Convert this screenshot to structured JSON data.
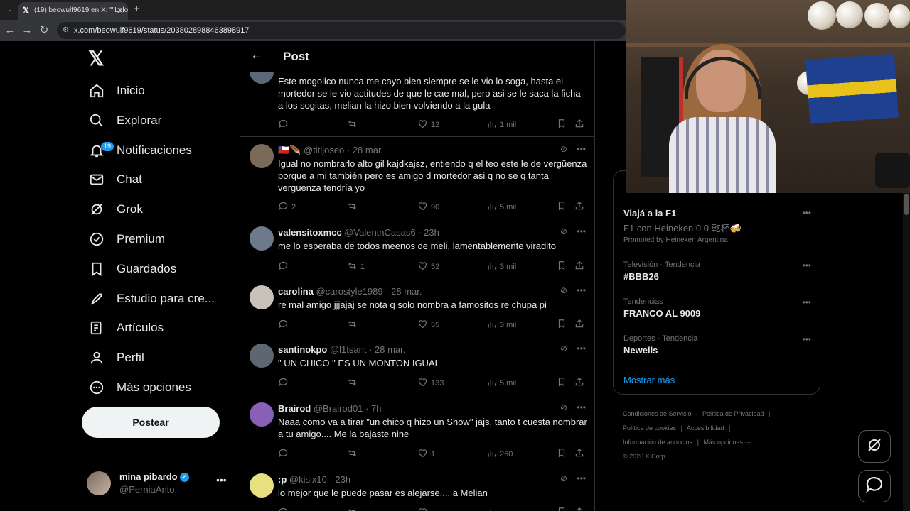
{
  "browser": {
    "tab_title": "(19) beowulf9619 en X: \"\"Lolo c",
    "url": "x.com/beowulf9619/status/2038028988463898917"
  },
  "sidebar": {
    "items": [
      {
        "label": "Inicio",
        "icon": "home-icon"
      },
      {
        "label": "Explorar",
        "icon": "search-icon"
      },
      {
        "label": "Notificaciones",
        "icon": "bell-icon",
        "badge": "19"
      },
      {
        "label": "Chat",
        "icon": "mail-icon"
      },
      {
        "label": "Grok",
        "icon": "grok-icon"
      },
      {
        "label": "Premium",
        "icon": "verified-badge-icon"
      },
      {
        "label": "Guardados",
        "icon": "bookmark-icon"
      },
      {
        "label": "Estudio para cre...",
        "icon": "rocket-icon"
      },
      {
        "label": "Artículos",
        "icon": "article-icon"
      },
      {
        "label": "Perfil",
        "icon": "person-icon"
      },
      {
        "label": "Más opciones",
        "icon": "more-circle-icon"
      }
    ],
    "post_button": "Postear",
    "account": {
      "name": "mina pibardo",
      "handle": "@PerniaAnto"
    }
  },
  "main": {
    "title": "Post",
    "replies": [
      {
        "name": "",
        "handle": "",
        "time": "",
        "text": "Este mogolico nunca me cayo bien siempre se le vio lo soga, hasta el mortedor se le vio actitudes de que le cae mal, pero asi se le saca la ficha a los sogitas, melian la hizo bien volviendo a la gula",
        "replies": "",
        "reposts": "",
        "likes": "12",
        "views": "1 mil"
      },
      {
        "name": "🇨🇱🪶",
        "handle": "@titijoseo",
        "time": "· 28 mar.",
        "text": "Igual no nombrarlo alto gil kajdkajsz, entiendo q el teo este le de vergüenza porque a mi también pero es amigo d mortedor asi q no se q tanta vergüenza tendría yo",
        "replies": "2",
        "reposts": "",
        "likes": "90",
        "views": "5 mil"
      },
      {
        "name": "valensitoxmcc",
        "handle": "@ValentnCasas6",
        "time": "· 23h",
        "text": "me lo esperaba de todos meenos de meli, lamentablemente viradito",
        "replies": "",
        "reposts": "1",
        "likes": "52",
        "views": "3 mil"
      },
      {
        "name": "carolina",
        "handle": "@carostyle1989",
        "time": "· 28 mar.",
        "text": "re mal amigo jjjajaj se nota q solo nombra a famositos re chupa pi",
        "replies": "",
        "reposts": "",
        "likes": "55",
        "views": "3 mil"
      },
      {
        "name": "santinokpo",
        "handle": "@l1tsant",
        "time": "· 28 mar.",
        "text": "\" UN CHICO \" ES UN MONTON IGUAL",
        "replies": "",
        "reposts": "",
        "likes": "133",
        "views": "5 mil"
      },
      {
        "name": "Brairod",
        "handle": "@Brairod01",
        "time": "· 7h",
        "text": "Naaa como va a tirar \"un chico q hizo un Show\" jajs, tanto t cuesta nombrar a tu amigo.... Me la bajaste nine",
        "replies": "",
        "reposts": "",
        "likes": "1",
        "views": "260"
      },
      {
        "name": ":p",
        "handle": "@kisix10",
        "time": "· 23h",
        "text": "lo mejor que le puede pasar es alejarse.... a Melian",
        "replies": "",
        "reposts": "",
        "likes": "",
        "views": ""
      }
    ]
  },
  "right": {
    "promo": {
      "title": "Viajá a la F1",
      "subtitle": "F1 con Heineken 0.0 乾杯🍻",
      "by": "Promoted by Heineken Argentina"
    },
    "trends": [
      {
        "category": "Televisión · Tendencia",
        "title": "#BBB26"
      },
      {
        "category": "Tendencias",
        "title": "FRANCO AL 9009"
      },
      {
        "category": "Deportes · Tendencia",
        "title": "Newells"
      }
    ],
    "show_more": "Mostrar más",
    "footer": [
      "Condiciones de Servicio",
      "|",
      "Política de Privacidad",
      "|",
      "Política de cookies",
      "|",
      "Accesibilidad",
      "|",
      "Información de anuncios",
      "|",
      "Más opciones ···",
      "© 2026 X Corp."
    ]
  },
  "colors": {
    "accent": "#1d9bf0",
    "bg": "#000000",
    "muted": "#71767b",
    "border": "#2f3336"
  }
}
